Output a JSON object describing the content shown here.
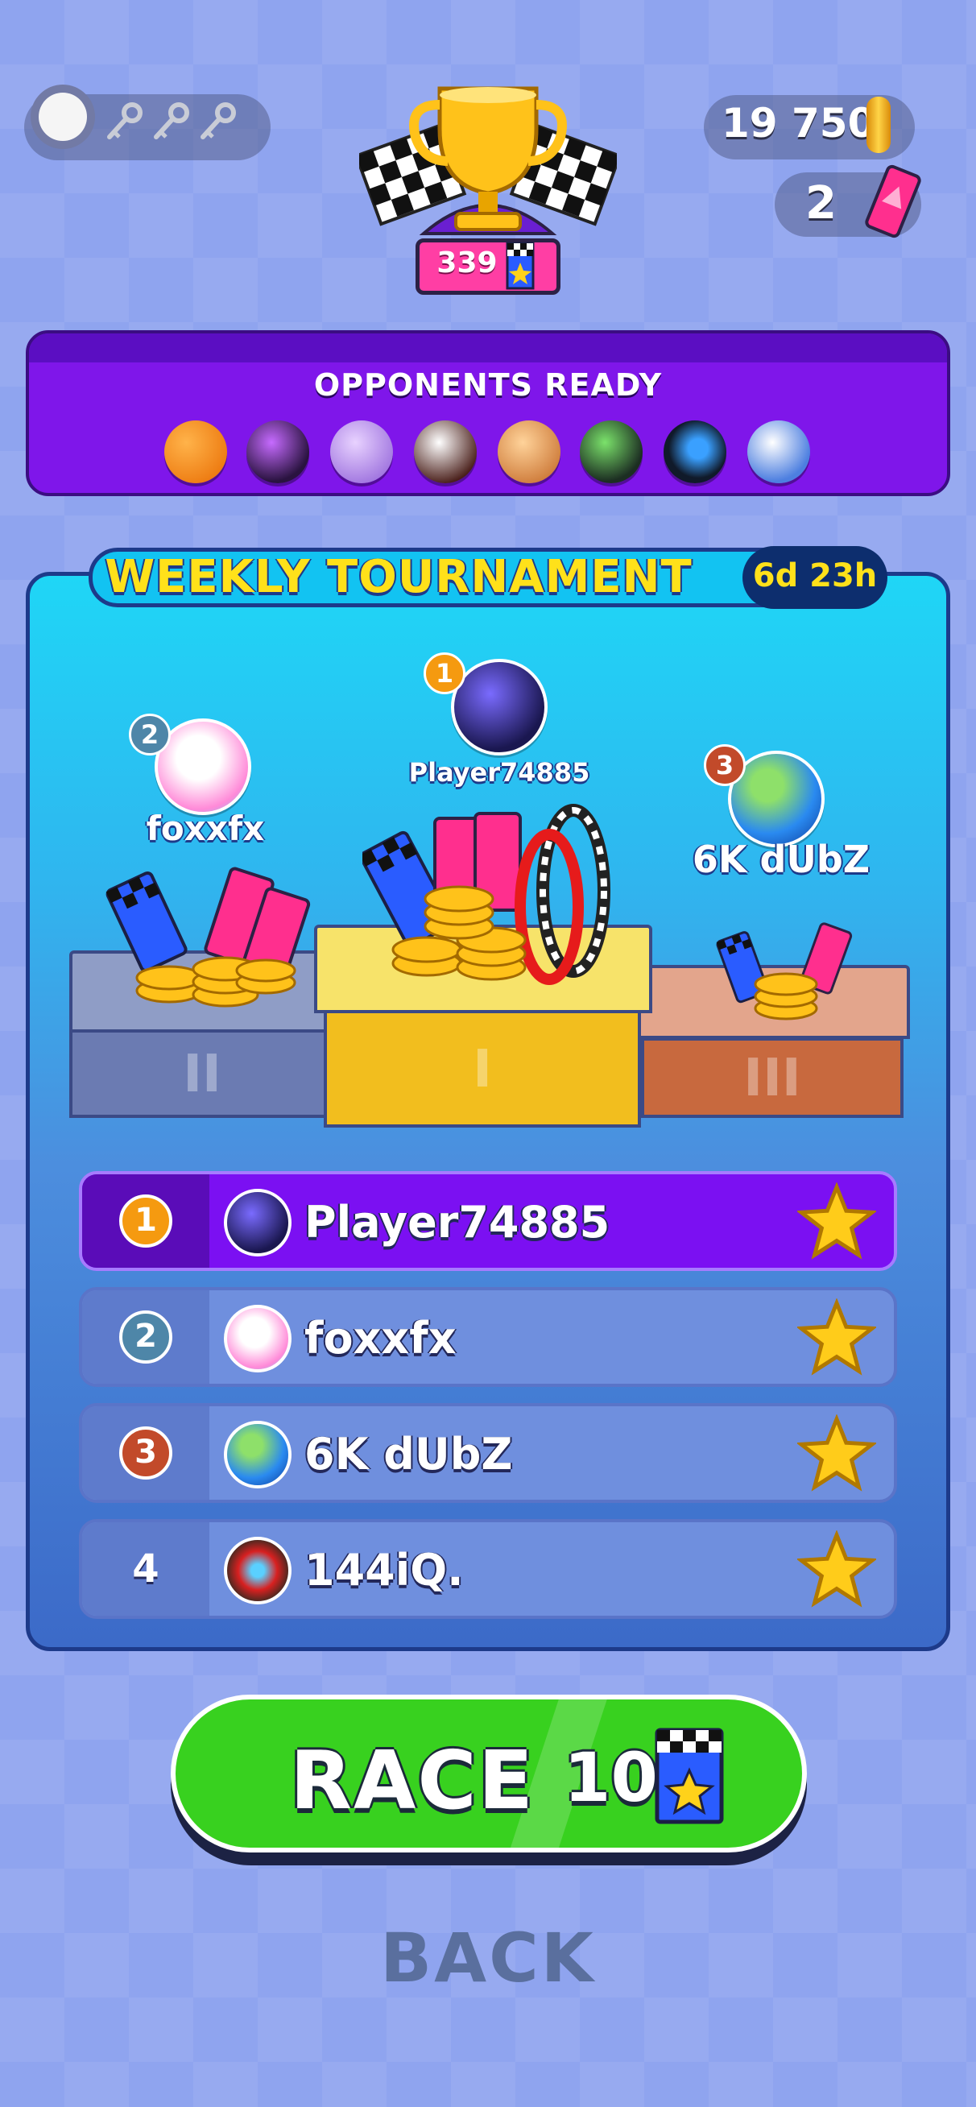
{
  "currency": {
    "coins": "19 750",
    "tickets": "2"
  },
  "trophy": {
    "count": "339"
  },
  "opponents": {
    "title": "OPPONENTS READY",
    "balls": [
      "pumpkin-ball",
      "purple-feather-ball",
      "purple-pattern-ball",
      "swirl-ball",
      "hamster-ball",
      "green-stars-ball",
      "blue-tire-ball",
      "astronaut-ball"
    ]
  },
  "tournament": {
    "title": "WEEKLY TOURNAMENT",
    "timer": "6d 23h"
  },
  "podium": {
    "first": {
      "rank": "1",
      "name": "Player74885"
    },
    "second": {
      "rank": "2",
      "name": "foxxfx"
    },
    "third": {
      "rank": "3",
      "name": "6K dUbZ"
    }
  },
  "leaderboard": [
    {
      "rank": "1",
      "name": "Player74885"
    },
    {
      "rank": "2",
      "name": "foxxfx"
    },
    {
      "rank": "3",
      "name": "6K dUbZ"
    },
    {
      "rank": "4",
      "name": "144iQ."
    }
  ],
  "actions": {
    "race_label": "RACE",
    "race_cost": "10",
    "back_label": "BACK"
  },
  "colors": {
    "background": "#8fa4ef",
    "panel_purple": "#7f16ea",
    "race_green": "#38d11f",
    "gold": "#ffe11a",
    "row_highlight": "#7b10f2",
    "row_default": "#6f8fde"
  }
}
